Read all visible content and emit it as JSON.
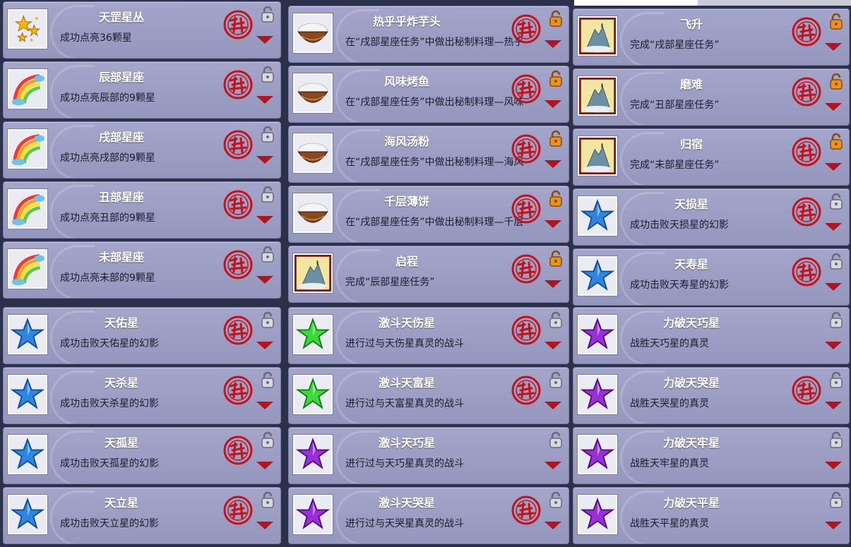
{
  "colors": {
    "stamp_red": "#c4121a",
    "card_bg": "#9b9cc3",
    "arrow": "#b0151f"
  },
  "panels": [
    {
      "cards": [
        {
          "title": "天罡星丛",
          "desc": "成功点亮36颗星",
          "icon": "gold-stars-icon",
          "completed": true,
          "lock": "silver-lock-icon"
        },
        {
          "title": "辰部星座",
          "desc": "成功点亮辰部的9颗星",
          "icon": "rainbow-icon",
          "completed": true,
          "lock": "silver-lock-icon"
        },
        {
          "title": "戌部星座",
          "desc": "成功点亮戌部的9颗星",
          "icon": "rainbow-icon",
          "completed": true,
          "lock": "silver-lock-icon"
        },
        {
          "title": "丑部星座",
          "desc": "成功点亮丑部的9颗星",
          "icon": "rainbow-icon",
          "completed": true,
          "lock": "silver-lock-icon"
        },
        {
          "title": "未部星座",
          "desc": "成功点亮未部的9颗星",
          "icon": "rainbow-icon",
          "completed": true,
          "lock": "silver-lock-icon"
        }
      ]
    },
    {
      "cards": [
        {
          "title": "热乎乎炸芋头",
          "desc": "在“戌部星座任务”中做出秘制料理—热乎",
          "icon": "rice-bowl-icon",
          "completed": true,
          "lock": "gold-lock-icon"
        },
        {
          "title": "风味烤鱼",
          "desc": "在“戌部星座任务”中做出秘制料理—风味",
          "icon": "rice-bowl-icon",
          "completed": true,
          "lock": "gold-lock-icon"
        },
        {
          "title": "海风汤粉",
          "desc": "在“戌部星座任务”中做出秘制料理—海风",
          "icon": "rice-bowl-icon",
          "completed": true,
          "lock": "gold-lock-icon"
        },
        {
          "title": "千层薄饼",
          "desc": "在“戌部星座任务”中做出秘制料理—千层",
          "icon": "rice-bowl-icon",
          "completed": true,
          "lock": "gold-lock-icon"
        },
        {
          "title": "启程",
          "desc": "完成“辰部星座任务”",
          "icon": "mountain-peak-icon",
          "completed": true,
          "lock": "gold-lock-icon"
        }
      ]
    },
    {
      "cards": [
        {
          "title": "飞升",
          "desc": "完成“戌部星座任务”",
          "icon": "mountain-peak-icon",
          "completed": true,
          "lock": "gold-lock-icon"
        },
        {
          "title": "磨难",
          "desc": "完成“丑部星座任务”",
          "icon": "mountain-peak-icon",
          "completed": true,
          "lock": "gold-lock-icon"
        },
        {
          "title": "归宿",
          "desc": "完成“未部星座任务”",
          "icon": "mountain-peak-icon",
          "completed": true,
          "lock": "gold-lock-icon"
        },
        {
          "title": "天损星",
          "desc": "成功击败天损星的幻影",
          "icon": "blue-star-icon",
          "completed": true,
          "lock": "silver-lock-icon"
        },
        {
          "title": "天寿星",
          "desc": "成功击败天寿星的幻影",
          "icon": "blue-star-icon",
          "completed": true,
          "lock": "silver-lock-icon"
        }
      ]
    },
    {
      "cards": [
        {
          "title": "天佑星",
          "desc": "成功击败天佑星的幻影",
          "icon": "blue-star-icon",
          "completed": true,
          "lock": "silver-lock-icon"
        },
        {
          "title": "天杀星",
          "desc": "成功击败天杀星的幻影",
          "icon": "blue-star-icon",
          "completed": true,
          "lock": "silver-lock-icon"
        },
        {
          "title": "天孤星",
          "desc": "成功击败天孤星的幻影",
          "icon": "blue-star-icon",
          "completed": true,
          "lock": "silver-lock-icon"
        },
        {
          "title": "天立星",
          "desc": "成功击败天立星的幻影",
          "icon": "blue-star-icon",
          "completed": true,
          "lock": "silver-lock-icon"
        }
      ]
    },
    {
      "cards": [
        {
          "title": "激斗天伤星",
          "desc": "进行过与天伤星真灵的战斗",
          "icon": "green-star-icon",
          "completed": true,
          "lock": "silver-lock-icon"
        },
        {
          "title": "激斗天富星",
          "desc": "进行过与天富星真灵的战斗",
          "icon": "green-star-icon",
          "completed": true,
          "lock": "silver-lock-icon"
        },
        {
          "title": "激斗天巧星",
          "desc": "进行过与天巧星真灵的战斗",
          "icon": "purple-star-icon",
          "completed": false,
          "lock": "silver-lock-icon"
        },
        {
          "title": "激斗天哭星",
          "desc": "进行过与天哭星真灵的战斗",
          "icon": "purple-star-icon",
          "completed": true,
          "lock": "silver-lock-icon"
        }
      ]
    },
    {
      "cards": [
        {
          "title": "力破天巧星",
          "desc": "战胜天巧星的真灵",
          "icon": "purple-star-icon",
          "completed": false,
          "lock": "silver-lock-icon"
        },
        {
          "title": "力破天哭星",
          "desc": "战胜天哭星的真灵",
          "icon": "purple-star-icon",
          "completed": true,
          "lock": "silver-lock-icon"
        },
        {
          "title": "力破天牢星",
          "desc": "战胜天牢星的真灵",
          "icon": "purple-star-icon",
          "completed": false,
          "lock": "silver-lock-icon"
        },
        {
          "title": "力破天平星",
          "desc": "战胜天平星的真灵",
          "icon": "purple-star-icon",
          "completed": false,
          "lock": "silver-lock-icon"
        }
      ]
    }
  ]
}
